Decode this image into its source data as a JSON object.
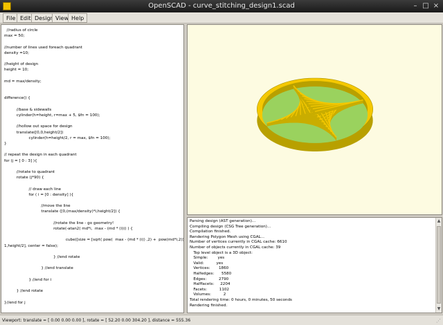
{
  "window": {
    "title": "OpenSCAD - curve_stitching_design1.scad",
    "minimize_glyph": "–",
    "maximize_glyph": "□",
    "close_glyph": "×"
  },
  "menu": {
    "items": [
      "File",
      "Edit",
      "Design",
      "View",
      "Help"
    ]
  },
  "editor": {
    "lines": [
      "  //radius of circle",
      "max = 50;",
      "",
      "//number of lines used foreach quadrant",
      "density =10;",
      "",
      "//height of design",
      "height = 10;",
      "",
      "md = max/density;",
      "",
      "",
      "difference() {",
      "",
      "          //base & sidewalls",
      "          cylinder(h=height, r=max + 5, $fn = 100);",
      "",
      "          //hollow out space for design",
      "          translate([0,0,height/2])",
      "                    cylinder(h=height/2, r = max, $fn = 100);",
      "}",
      "",
      "// repeat the design in each quadrant",
      "for (j = [ 0 : 3] ){",
      "",
      "          //rotate to quadrant",
      "          rotate (j*90) {",
      "",
      "                    // draw each line",
      "                    for ( i = [0 : density] ){",
      "",
      "                              //move the line",
      "                              translate ([0,(max/density)*i,height/2]) {",
      "",
      "                                        //rotate the line - go geometry!",
      "                                        rotate(-atan2( md*i,  max - (md * (i))) ) {",
      "",
      "                                                  cube([size = [sqrt( pow(  max - (md * (i)) ,2) +  pow(md*i,2)) ,",
      "1,height/2], center = false);",
      "",
      "                                        } //end rotate",
      "",
      "                              } //end translate",
      "",
      "                    } //end for i",
      "",
      "          } //end rotate",
      "",
      "}//end for j"
    ]
  },
  "viewport": {
    "rim_top_color": "#f5c800",
    "rim_side_color": "#b8a000",
    "floor_color": "#9ad25e",
    "background_color": "#fdfbe1"
  },
  "console": {
    "lines": [
      "Parsing design (AST generation)...",
      "Compiling design (CSG Tree generation)...",
      "Compilation finished.",
      "Rendering Polygon Mesh using CGAL...",
      "Number of vertices currently in CGAL cache: 6610",
      "Number of objects currently in CGAL cache: 39",
      "   Top level object is a 3D object:",
      "   Simple:        yes",
      "   Valid:          yes",
      "   Vertices:       1860",
      "   Halfedges:      5580",
      "   Edges:          2790",
      "   Halffacets:     2204",
      "   Facets:          1102",
      "   Volumes:          2",
      "Total rendering time: 0 hours, 0 minutes, 50 seconds",
      "Rendering finished."
    ],
    "scroll_up_glyph": "▲",
    "scroll_down_glyph": "▼"
  },
  "status": {
    "text": "Viewport: translate = [ 0.00 0.00 0.00 ], rotate = [ 52.20 0.00 304.20 ], distance = 555.36"
  }
}
